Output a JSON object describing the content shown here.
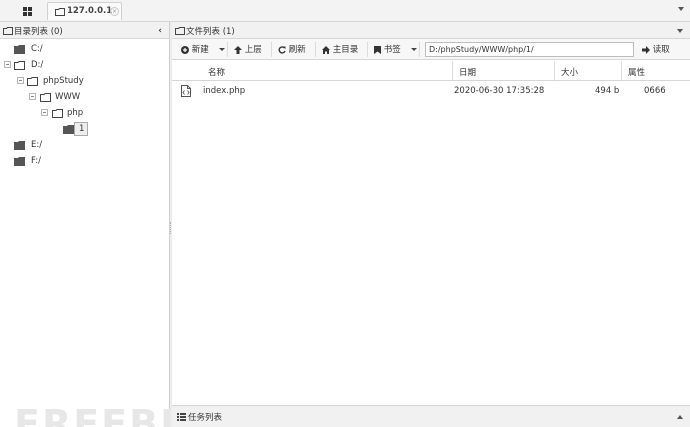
{
  "tabbar": {
    "tab_label": "127.0.0.1",
    "tab_close": "×"
  },
  "left_panel": {
    "title": "目录列表 (0)",
    "tree": [
      {
        "label": "C:/"
      },
      {
        "label": "D:/"
      },
      {
        "label": "phpStudy"
      },
      {
        "label": "WWW"
      },
      {
        "label": "php"
      },
      {
        "label": "1"
      },
      {
        "label": "E:/"
      },
      {
        "label": "F:/"
      }
    ]
  },
  "right_panel": {
    "title": "文件列表 (1)",
    "toolbar": {
      "new_label": "新建",
      "up_label": "上层",
      "refresh_label": "刷新",
      "home_label": "主目录",
      "bookmark_label": "书签",
      "path_value": "D:/phpStudy/WWW/php/1/",
      "read_label": "读取"
    },
    "columns": {
      "name": "名称",
      "date": "日期",
      "size": "大小",
      "perm": "属性"
    },
    "files": [
      {
        "name": "index.php",
        "date": "2020-06-30 17:35:28",
        "size": "494 b",
        "perm": "0666"
      }
    ]
  },
  "task_bar": {
    "title": "任务列表"
  },
  "watermark": "FREEBUF",
  "icons": [
    "grid-icon",
    "folder-icon",
    "close-icon",
    "chevron-left-icon",
    "plus-circle-icon",
    "arrow-up-icon",
    "refresh-icon",
    "home-icon",
    "bookmark-icon",
    "arrow-right-icon",
    "php-file-icon",
    "chevron-down-icon",
    "chevron-up-icon",
    "list-icon"
  ],
  "colors": {
    "panel_header_bg": "#f1f1f1",
    "border": "#d6d6d6",
    "text": "#333333",
    "folder_fill": "#555555"
  }
}
